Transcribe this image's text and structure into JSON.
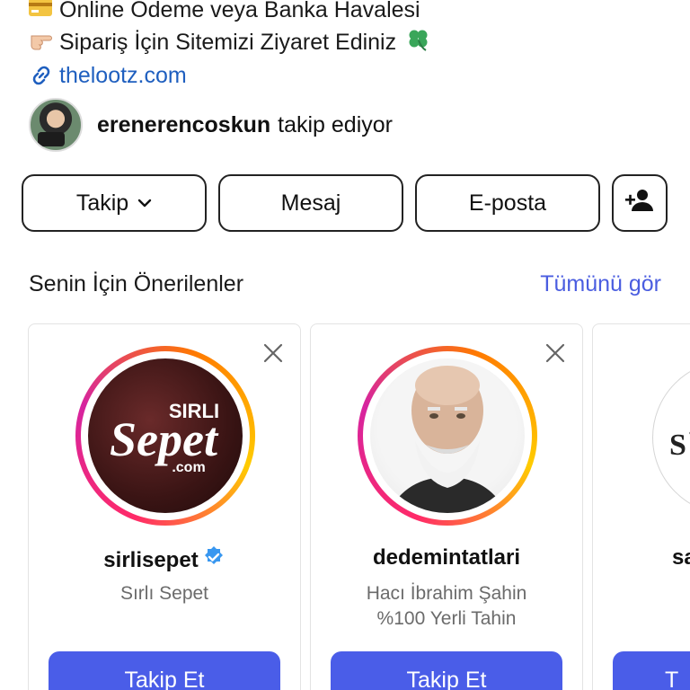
{
  "bio": {
    "line1": "Online Ödeme veya Banka Havalesi",
    "line2": "Sipariş İçin Sitemizi Ziyaret Ediniz",
    "line2_emoji": "🍀",
    "link": "thelootz.com"
  },
  "followed_by": {
    "username": "ereneren­coskun",
    "username_plain": "erenerencoskun",
    "suffix": "takip ediyor"
  },
  "actions": {
    "follow_label": "Takip",
    "message_label": "Mesaj",
    "email_label": "E-posta"
  },
  "suggested": {
    "title": "Senin İçin Önerilenler",
    "see_all": "Tümünü gör",
    "cards": [
      {
        "username": "sirlisepet",
        "subtitle": "Sırlı Sepet",
        "button": "Takip Et",
        "verified": true
      },
      {
        "username": "dedemintatlari",
        "subtitle_1": "Hacı İbrahim Şahin",
        "subtitle_2": "%100 Yerli Tahin",
        "button": "Takip Et",
        "verified": false
      },
      {
        "username_fragment": "sa",
        "button": "T"
      }
    ]
  },
  "colors": {
    "link": "#1f5fbf",
    "accent": "#4a5de8",
    "see_all": "#4a5de0",
    "verified": "#3897f0"
  }
}
